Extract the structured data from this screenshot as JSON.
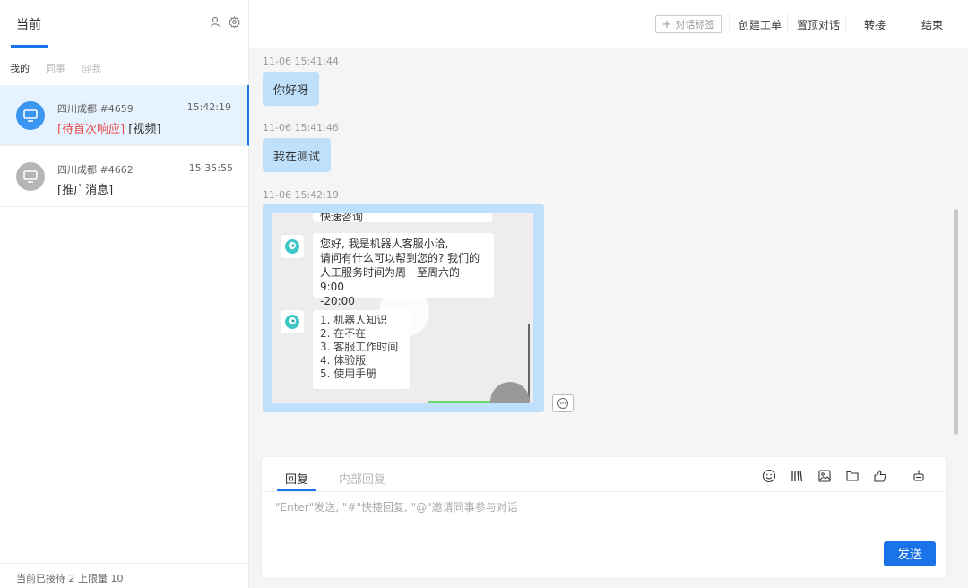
{
  "left": {
    "current_tab": "当前",
    "filters": [
      "我的",
      "同事",
      "@我"
    ],
    "conversations": [
      {
        "name": "四川成都 #4659",
        "time": "15:42:19",
        "pending": "[待首次响应]",
        "last": "[视频]"
      },
      {
        "name": "四川成都 #4662",
        "time": "15:35:55",
        "pending": "",
        "last": "[推广消息]"
      }
    ],
    "footer": "当前已接待 2 上限量 10"
  },
  "topbar": {
    "tag_btn": "对话标签",
    "actions": [
      "创建工单",
      "置顶对话",
      "转接",
      "结束"
    ]
  },
  "chat": {
    "messages": [
      {
        "time": "11-06 15:41:44",
        "text": "你好呀"
      },
      {
        "time": "11-06 15:41:46",
        "text": "我在测试"
      },
      {
        "time": "11-06 15:42:19",
        "text": ""
      }
    ],
    "video": {
      "top_partial": "快速咨询",
      "bot_msg": [
        "您好, 我是机器人客服小洽,",
        "请问有什么可以帮到您的? 我们的",
        "人工服务时间为周一至周六的 9:00",
        "-20:00"
      ],
      "menu": [
        "1. 机器人知识",
        "2. 在不在",
        "3. 客服工作时间",
        "4. 体验版",
        "5. 使用手册"
      ]
    }
  },
  "compose": {
    "tab_reply": "回复",
    "tab_internal": "内部回复",
    "placeholder": "\"Enter\"发送, \"#\"快捷回复, \"@\"邀请同事参与对话",
    "send": "发送"
  },
  "colors": {
    "accent": "#1a73e8",
    "bubble": "#bfe0fb",
    "pending": "#e64a4a"
  }
}
